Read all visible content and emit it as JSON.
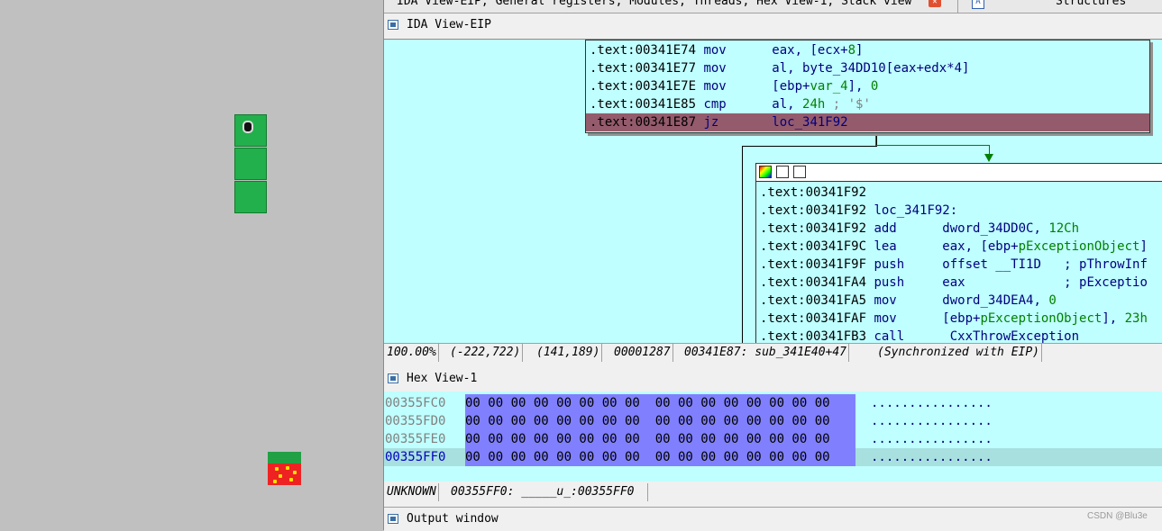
{
  "game": {
    "snake_segments": 3,
    "colors": {
      "background": "#c0c0c0",
      "snake": "#22b04c",
      "food": "#ee2222"
    },
    "icons": [
      "snake-head-icon",
      "strawberry-icon"
    ]
  },
  "ida": {
    "tabs_text": "IDA View-EIP, General registers, Modules, Threads, Hex View-1, Stack view",
    "structures_tab": "Structures",
    "ida_view_title": "IDA View-EIP",
    "node1": [
      {
        "addr": ".text:00341E74",
        "mnem": "mov",
        "ops": "eax, [ecx+",
        "num": "8",
        "tail": "]"
      },
      {
        "addr": ".text:00341E77",
        "mnem": "mov",
        "ops": "al, byte_34DD10[eax+edx*4]",
        "num": "",
        "tail": ""
      },
      {
        "addr": ".text:00341E7E",
        "mnem": "mov",
        "ops": "[ebp+",
        "var": "var_4",
        "tail": "], ",
        "num": "0"
      },
      {
        "addr": ".text:00341E85",
        "mnem": "cmp",
        "ops": "al, ",
        "num": "24h",
        "comment": " ; '$'"
      },
      {
        "addr": ".text:00341E87",
        "mnem": "jz",
        "ops": "loc_341F92",
        "num": "",
        "tail": ""
      }
    ],
    "node2": [
      {
        "addr": ".text:00341F92",
        "rest": ""
      },
      {
        "addr": ".text:00341F92",
        "rest": "loc_341F92:"
      },
      {
        "addr": ".text:00341F92",
        "mnem": "add",
        "ops": "dword_34DD0C, ",
        "num": "12Ch"
      },
      {
        "addr": ".text:00341F9C",
        "mnem": "lea",
        "ops": "eax, [ebp+",
        "var": "pExceptionObject",
        "tail": "]"
      },
      {
        "addr": ".text:00341F9F",
        "mnem": "push",
        "ops": "offset __TI1D",
        "comment": "   ; pThrowInf"
      },
      {
        "addr": ".text:00341FA4",
        "mnem": "push",
        "ops": "eax",
        "comment": "             ; pExceptio"
      },
      {
        "addr": ".text:00341FA5",
        "mnem": "mov",
        "ops": "dword_34DEA4, ",
        "num": "0"
      },
      {
        "addr": ".text:00341FAF",
        "mnem": "mov",
        "ops": "[ebp+",
        "var": "pExceptionObject",
        "tail": "], ",
        "num": "23h"
      },
      {
        "addr": ".text:00341FB3",
        "mnem": "call",
        "ops": " CxxThrowException"
      }
    ],
    "status": {
      "zoom": "100.00%",
      "coords": "(-222,722)",
      "pos": "(141,189)",
      "offset": "00001287",
      "loc": "00341E87: sub_341E40+47",
      "sync": "(Synchronized with EIP)"
    },
    "hex_title": "Hex View-1",
    "hex_rows": [
      {
        "addr": "00355FC0",
        "bytes": "00 00 00 00 00 00 00 00  00 00 00 00 00 00 00 00",
        "ascii": "................"
      },
      {
        "addr": "00355FD0",
        "bytes": "00 00 00 00 00 00 00 00  00 00 00 00 00 00 00 00",
        "ascii": "................"
      },
      {
        "addr": "00355FE0",
        "bytes": "00 00 00 00 00 00 00 00  00 00 00 00 00 00 00 00",
        "ascii": "................"
      },
      {
        "addr": "00355FF0",
        "bytes": "00 00 00 00 00 00 00 00  00 00 00 00 00 00 00 00",
        "ascii": "................"
      }
    ],
    "hex_status": {
      "seg": "UNKNOWN",
      "loc": "00355FF0: _____u_:00355FF0"
    },
    "output_title": "Output window",
    "watermark": "CSDN @Blu3e"
  }
}
